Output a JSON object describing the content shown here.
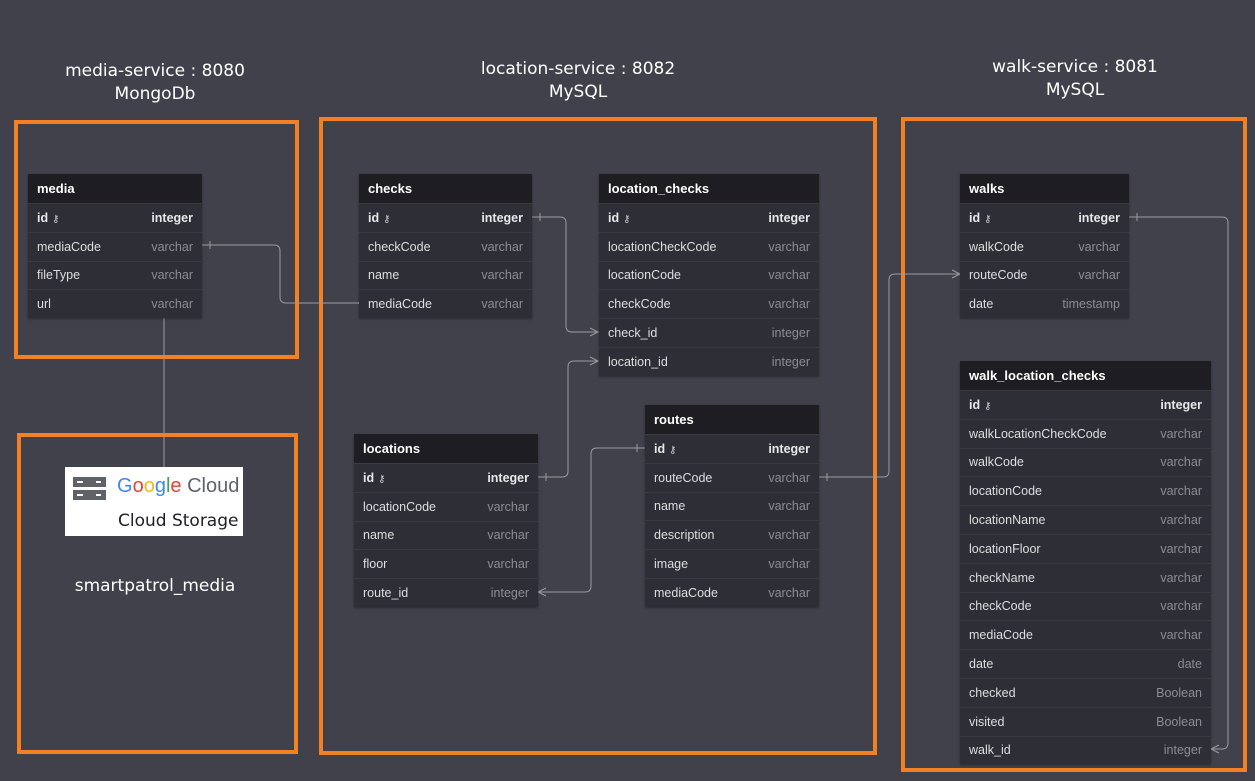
{
  "services": {
    "media": {
      "title": "media-service : 8080",
      "db": "MongoDb"
    },
    "location": {
      "title": "location-service : 8082",
      "db": "MySQL"
    },
    "walk": {
      "title": "walk-service : 8081",
      "db": "MySQL"
    }
  },
  "storage": {
    "google": [
      "G",
      "o",
      "o",
      "g",
      "l",
      "e"
    ],
    "cloud": "Cloud",
    "product": "Cloud Storage",
    "bucket": "smartpatrol_media"
  },
  "tables": {
    "media": {
      "name": "media",
      "fields": [
        {
          "name": "id",
          "type": "integer"
        },
        {
          "name": "mediaCode",
          "type": "varchar"
        },
        {
          "name": "fileType",
          "type": "varchar"
        },
        {
          "name": "url",
          "type": "varchar"
        }
      ]
    },
    "checks": {
      "name": "checks",
      "fields": [
        {
          "name": "id",
          "type": "integer"
        },
        {
          "name": "checkCode",
          "type": "varchar"
        },
        {
          "name": "name",
          "type": "varchar"
        },
        {
          "name": "mediaCode",
          "type": "varchar"
        }
      ]
    },
    "location_checks": {
      "name": "location_checks",
      "fields": [
        {
          "name": "id",
          "type": "integer"
        },
        {
          "name": "locationCheckCode",
          "type": "varchar"
        },
        {
          "name": "locationCode",
          "type": "varchar"
        },
        {
          "name": "checkCode",
          "type": "varchar"
        },
        {
          "name": "check_id",
          "type": "integer"
        },
        {
          "name": "location_id",
          "type": "integer"
        }
      ]
    },
    "locations": {
      "name": "locations",
      "fields": [
        {
          "name": "id",
          "type": "integer"
        },
        {
          "name": "locationCode",
          "type": "varchar"
        },
        {
          "name": "name",
          "type": "varchar"
        },
        {
          "name": "floor",
          "type": "varchar"
        },
        {
          "name": "route_id",
          "type": "integer"
        }
      ]
    },
    "routes": {
      "name": "routes",
      "fields": [
        {
          "name": "id",
          "type": "integer"
        },
        {
          "name": "routeCode",
          "type": "varchar"
        },
        {
          "name": "name",
          "type": "varchar"
        },
        {
          "name": "description",
          "type": "varchar"
        },
        {
          "name": "image",
          "type": "varchar"
        },
        {
          "name": "mediaCode",
          "type": "varchar"
        }
      ]
    },
    "walks": {
      "name": "walks",
      "fields": [
        {
          "name": "id",
          "type": "integer"
        },
        {
          "name": "walkCode",
          "type": "varchar"
        },
        {
          "name": "routeCode",
          "type": "varchar"
        },
        {
          "name": "date",
          "type": "timestamp"
        }
      ]
    },
    "walk_location_checks": {
      "name": "walk_location_checks",
      "fields": [
        {
          "name": "id",
          "type": "integer"
        },
        {
          "name": "walkLocationCheckCode",
          "type": "varchar"
        },
        {
          "name": "walkCode",
          "type": "varchar"
        },
        {
          "name": "locationCode",
          "type": "varchar"
        },
        {
          "name": "locationName",
          "type": "varchar"
        },
        {
          "name": "locationFloor",
          "type": "varchar"
        },
        {
          "name": "checkName",
          "type": "varchar"
        },
        {
          "name": "checkCode",
          "type": "varchar"
        },
        {
          "name": "mediaCode",
          "type": "varchar"
        },
        {
          "name": "date",
          "type": "date"
        },
        {
          "name": "checked",
          "type": "Boolean"
        },
        {
          "name": "visited",
          "type": "Boolean"
        },
        {
          "name": "walk_id",
          "type": "integer"
        }
      ]
    }
  },
  "colors": {
    "background": "#41414b",
    "service_border": "#f48024",
    "table_header": "#1d1d22",
    "table_body": "#2e2e36",
    "connector": "#9a9aa3"
  }
}
